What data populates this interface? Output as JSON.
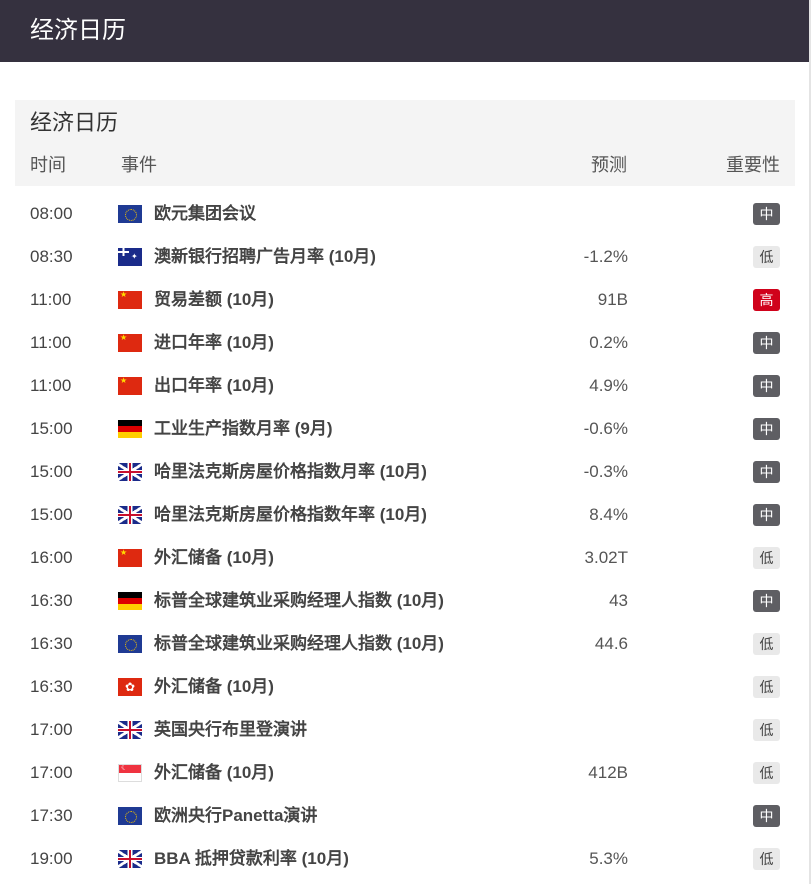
{
  "header": {
    "title": "经济日历"
  },
  "panel": {
    "title": "经济日历",
    "columns": {
      "time": "时间",
      "event": "事件",
      "forecast": "预测",
      "importance": "重要性"
    }
  },
  "colors": {
    "header_bg": "#35313f",
    "high": "#d0021b",
    "mid": "#5e5e63",
    "low": "#e9e9e9"
  },
  "rows": [
    {
      "time": "08:00",
      "flag": "eu-flag-icon",
      "event": "欧元集团会议",
      "forecast": "",
      "importance": "中",
      "level": "mid"
    },
    {
      "time": "08:30",
      "flag": "au-flag-icon",
      "event": "澳新银行招聘广告月率 (10月)",
      "forecast": "-1.2%",
      "importance": "低",
      "level": "low"
    },
    {
      "time": "11:00",
      "flag": "cn-flag-icon",
      "event": "贸易差额 (10月)",
      "forecast": "91B",
      "importance": "高",
      "level": "high"
    },
    {
      "time": "11:00",
      "flag": "cn-flag-icon",
      "event": "进口年率 (10月)",
      "forecast": "0.2%",
      "importance": "中",
      "level": "mid"
    },
    {
      "time": "11:00",
      "flag": "cn-flag-icon",
      "event": "出口年率 (10月)",
      "forecast": "4.9%",
      "importance": "中",
      "level": "mid"
    },
    {
      "time": "15:00",
      "flag": "de-flag-icon",
      "event": "工业生产指数月率 (9月)",
      "forecast": "-0.6%",
      "importance": "中",
      "level": "mid"
    },
    {
      "time": "15:00",
      "flag": "gb-flag-icon",
      "event": "哈里法克斯房屋价格指数月率 (10月)",
      "forecast": "-0.3%",
      "importance": "中",
      "level": "mid"
    },
    {
      "time": "15:00",
      "flag": "gb-flag-icon",
      "event": "哈里法克斯房屋价格指数年率 (10月)",
      "forecast": "8.4%",
      "importance": "中",
      "level": "mid"
    },
    {
      "time": "16:00",
      "flag": "cn-flag-icon",
      "event": "外汇储备 (10月)",
      "forecast": "3.02T",
      "importance": "低",
      "level": "low"
    },
    {
      "time": "16:30",
      "flag": "de-flag-icon",
      "event": "标普全球建筑业采购经理人指数 (10月)",
      "forecast": "43",
      "importance": "中",
      "level": "mid"
    },
    {
      "time": "16:30",
      "flag": "eu-flag-icon",
      "event": "标普全球建筑业采购经理人指数 (10月)",
      "forecast": "44.6",
      "importance": "低",
      "level": "low"
    },
    {
      "time": "16:30",
      "flag": "hk-flag-icon",
      "event": "外汇储备 (10月)",
      "forecast": "",
      "importance": "低",
      "level": "low"
    },
    {
      "time": "17:00",
      "flag": "gb-flag-icon",
      "event": "英国央行布里登演讲",
      "forecast": "",
      "importance": "低",
      "level": "low"
    },
    {
      "time": "17:00",
      "flag": "sg-flag-icon",
      "event": "外汇储备 (10月)",
      "forecast": "412B",
      "importance": "低",
      "level": "low"
    },
    {
      "time": "17:30",
      "flag": "eu-flag-icon",
      "event": "欧洲央行Panetta演讲",
      "forecast": "",
      "importance": "中",
      "level": "mid"
    },
    {
      "time": "19:00",
      "flag": "gb-flag-icon",
      "event": "BBA 抵押贷款利率 (10月)",
      "forecast": "5.3%",
      "importance": "低",
      "level": "low"
    }
  ]
}
